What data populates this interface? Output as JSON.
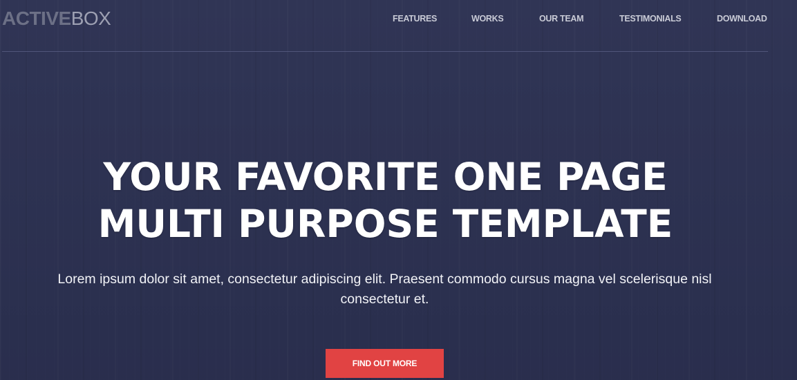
{
  "brand": {
    "bold": "ACTIVE",
    "light": "BOX"
  },
  "nav": {
    "items": [
      {
        "label": "FEATURES"
      },
      {
        "label": "WORKS"
      },
      {
        "label": "OUR TEAM"
      },
      {
        "label": "TESTIMONIALS"
      },
      {
        "label": "DOWNLOAD"
      }
    ]
  },
  "hero": {
    "headline_line1": "YOUR FAVORITE ONE PAGE",
    "headline_line2": "MULTI PURPOSE TEMPLATE",
    "subtext": "Lorem ipsum dolor sit amet, consectetur adipiscing elit. Praesent commodo cursus magna vel scelerisque nisl consectetur et.",
    "cta_label": "FIND OUT MORE"
  },
  "colors": {
    "background": "#2c3152",
    "accent": "#e14343",
    "text": "#ffffff"
  }
}
